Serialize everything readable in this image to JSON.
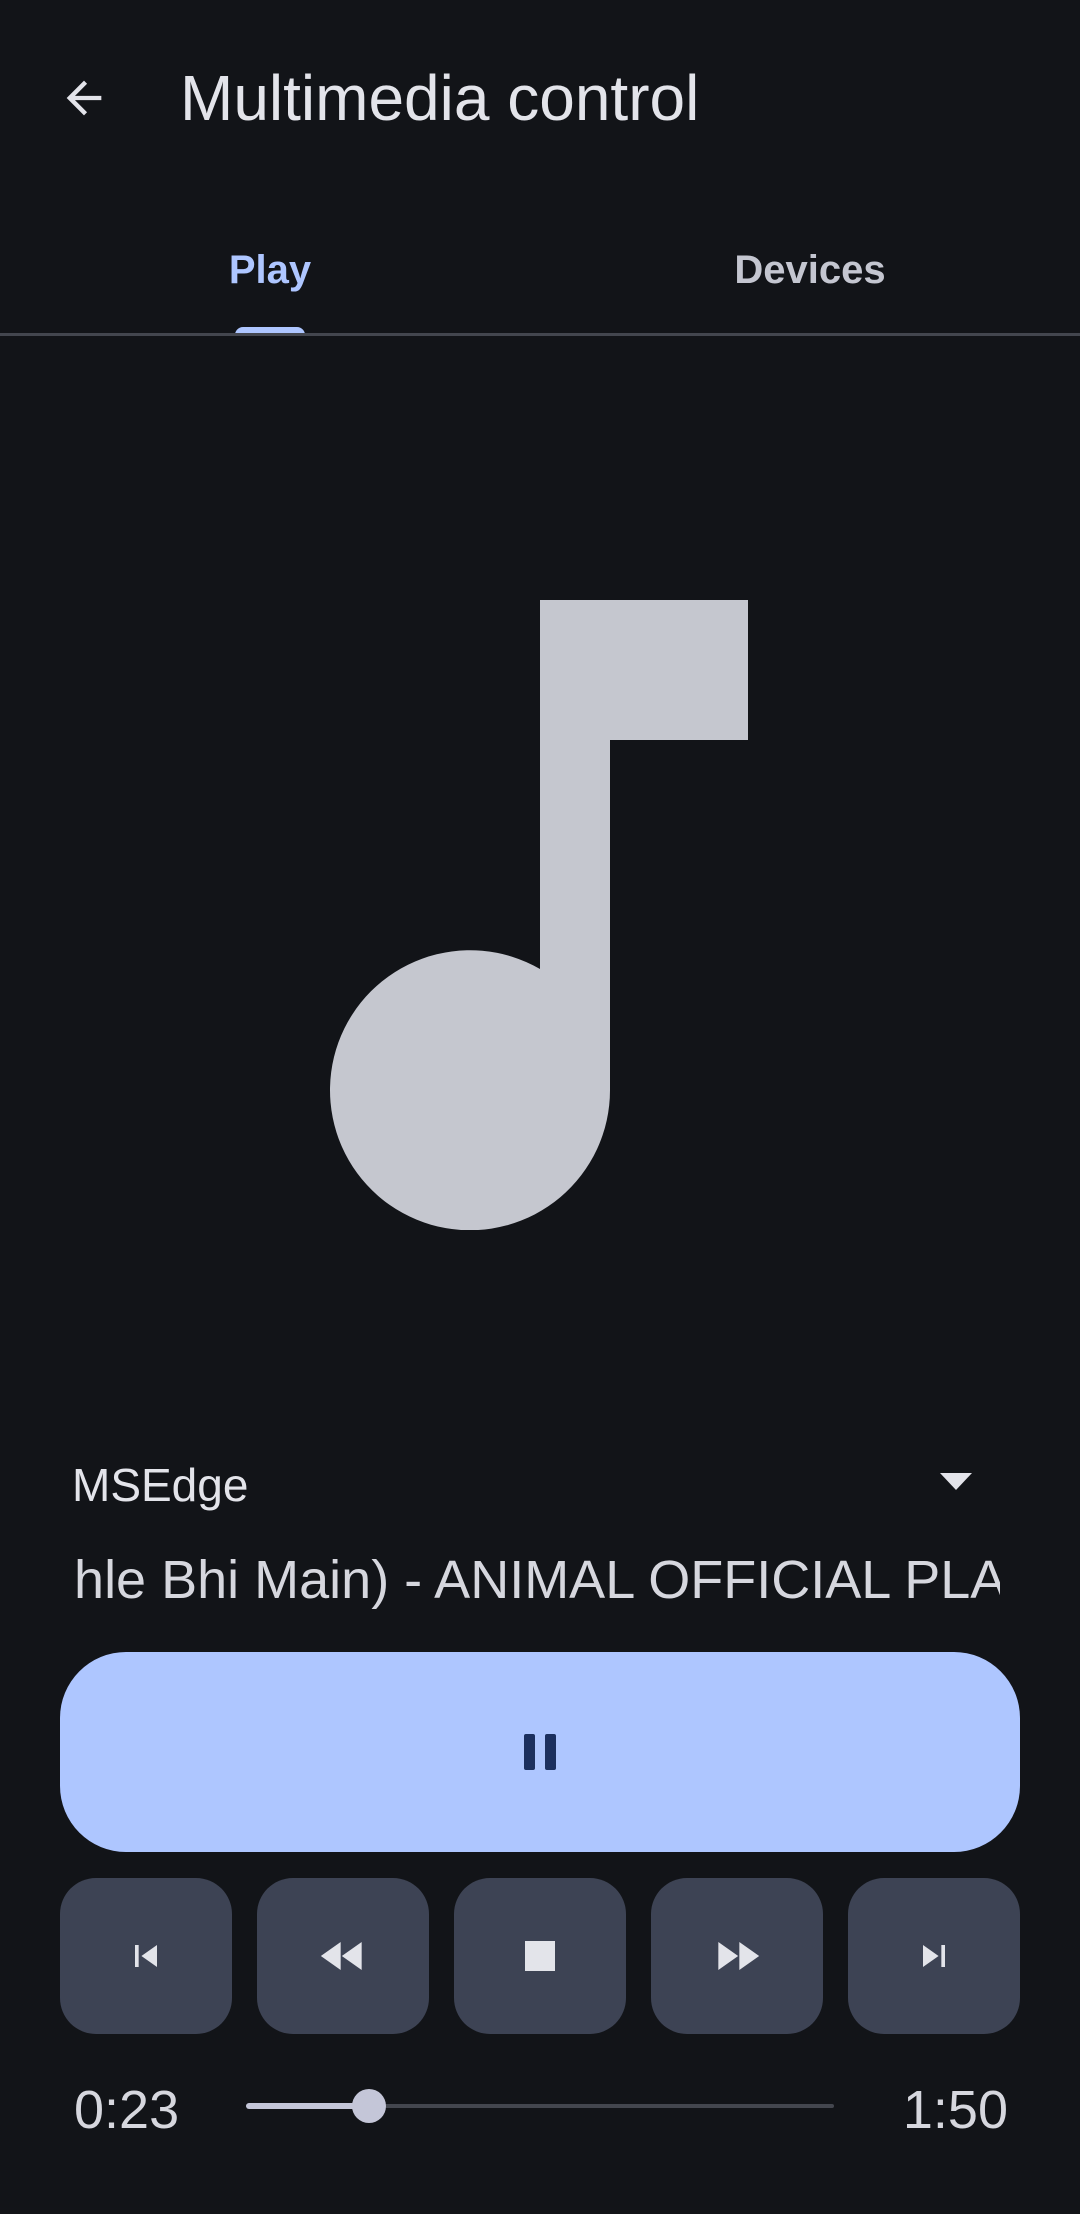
{
  "appbar": {
    "title": "Multimedia control",
    "back_icon": "arrow-left-icon"
  },
  "tabs": [
    {
      "label": "Play",
      "selected": true
    },
    {
      "label": "Devices",
      "selected": false
    }
  ],
  "artwork": {
    "icon": "music-note-icon"
  },
  "source": {
    "label": "MSEdge",
    "icon": "dropdown-caret-icon"
  },
  "track": {
    "title": "ehle Bhi Main) - ANIMAL OFFICIAL PLAY"
  },
  "controls": {
    "play_pause_icon": "pause-icon",
    "buttons": [
      "previous-track-icon",
      "rewind-icon",
      "stop-icon",
      "fast-forward-icon",
      "next-track-icon"
    ]
  },
  "progress": {
    "current": "0:23",
    "total": "1:50",
    "fraction": 0.21
  },
  "colors": {
    "background": "#121418",
    "accent": "#aec6ff",
    "secondary_button": "#3d4354",
    "on_accent": "#1b2f5e",
    "artwork": "#c5c7cf"
  }
}
